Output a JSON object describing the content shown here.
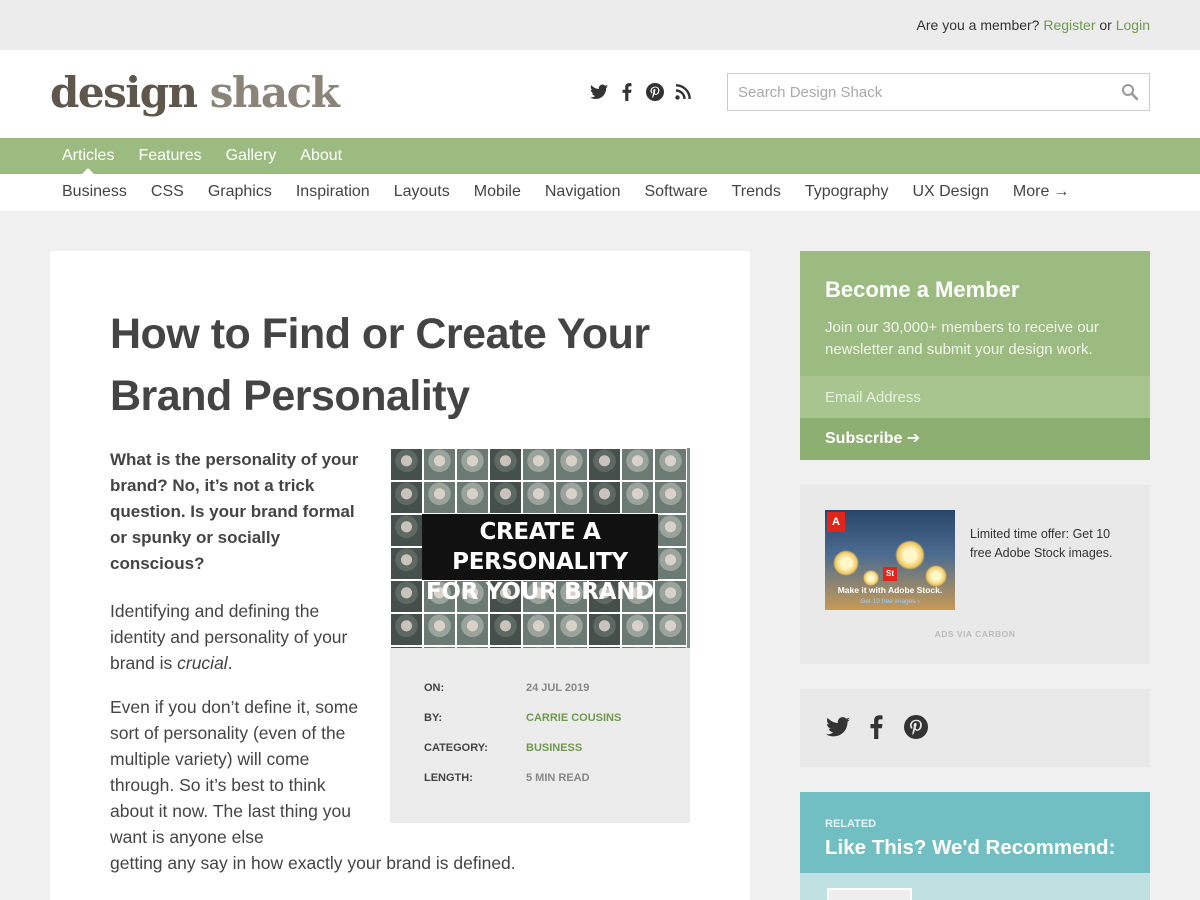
{
  "topbar": {
    "question": "Are you a member?",
    "register": "Register",
    "or": "or",
    "login": "Login"
  },
  "header": {
    "logo_part1": "design",
    "logo_part2": "shack",
    "search_placeholder": "Search Design Shack"
  },
  "social_top": [
    "twitter-icon",
    "facebook-icon",
    "pinterest-icon",
    "rss-icon"
  ],
  "nav": {
    "items": [
      "Articles",
      "Features",
      "Gallery",
      "About"
    ],
    "active": "Articles"
  },
  "subnav": {
    "items": [
      "Business",
      "CSS",
      "Graphics",
      "Inspiration",
      "Layouts",
      "Mobile",
      "Navigation",
      "Software",
      "Trends",
      "Typography",
      "UX Design"
    ],
    "more": "More",
    "more_arrow": "→"
  },
  "article": {
    "title": "How to Find or Create Your Brand Personality",
    "lede": "What is the personality of your brand? No, it’s not a trick question. Is your brand formal or spunky or socially conscious?",
    "p1_start": "Identifying and defining the identity and personality of your brand is ",
    "p1_em": "crucial",
    "p1_end": ".",
    "p2_wrapped": "Even if you don’t define it, some sort of personality (even of the multiple variety) will come through. So it’s best to think about it now. The last thing you want is anyone else",
    "p2_tail": "getting any say in how exactly your brand is defined.",
    "hero_line1": "CREATE A PERSONALITY",
    "hero_line2": "FOR YOUR BRAND",
    "meta": {
      "on_label": "ON:",
      "on_value": "24 JUL 2019",
      "by_label": "BY:",
      "by_value": "CARRIE COUSINS",
      "category_label": "CATEGORY:",
      "category_value": "BUSINESS",
      "length_label": "LENGTH:",
      "length_value": "5 MIN READ"
    }
  },
  "sidebar": {
    "member": {
      "title": "Become a Member",
      "text": "Join our 30,000+ members to receive our newsletter and submit your design work.",
      "email_placeholder": "Email Address",
      "subscribe": "Subscribe ➔"
    },
    "ad": {
      "badge": "A",
      "st": "St",
      "caption": "Make it with Adobe Stock.",
      "caption2": "Get 10 free images ›",
      "text": "Limited time offer: Get 10 free Adobe Stock images.",
      "via": "ADS VIA CARBON"
    },
    "share_icons": [
      "twitter-icon",
      "facebook-icon",
      "pinterest-icon"
    ],
    "related": {
      "label": "RELATED",
      "title": "Like This? We'd Recommend:"
    }
  },
  "colors": {
    "accent_green": "#9cbb80",
    "link_green": "#6f9a4f",
    "teal": "#71bfc3"
  }
}
